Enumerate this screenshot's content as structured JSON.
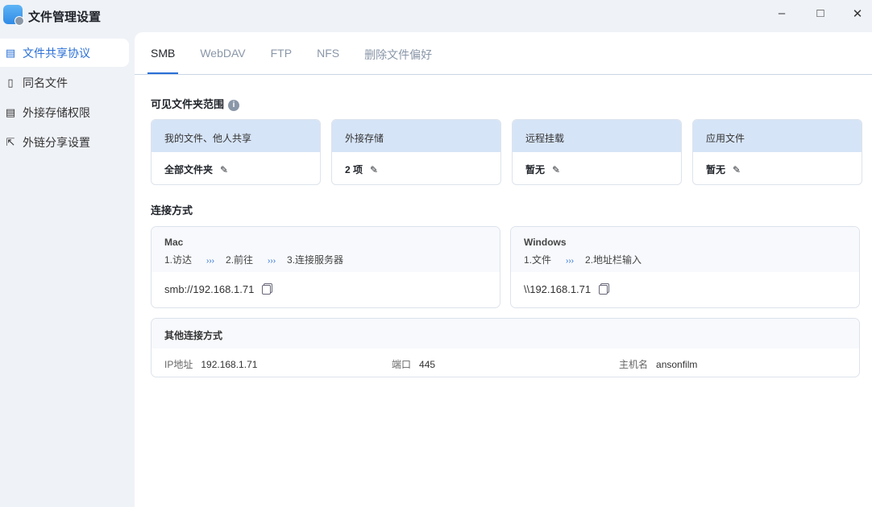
{
  "window": {
    "title": "文件管理设置"
  },
  "sidebar": {
    "items": [
      {
        "label": "文件共享协议"
      },
      {
        "label": "同名文件"
      },
      {
        "label": "外接存储权限"
      },
      {
        "label": "外链分享设置"
      }
    ]
  },
  "tabs": [
    "SMB",
    "WebDAV",
    "FTP",
    "NFS",
    "删除文件偏好"
  ],
  "visible_scope": {
    "title": "可见文件夹范围",
    "cards": [
      {
        "header": "我的文件、他人共享",
        "value": "全部文件夹"
      },
      {
        "header": "外接存储",
        "value": "2 项"
      },
      {
        "header": "远程挂载",
        "value": "暂无"
      },
      {
        "header": "应用文件",
        "value": "暂无"
      }
    ]
  },
  "connection": {
    "title": "连接方式",
    "mac": {
      "os": "Mac",
      "steps": [
        "1.访达",
        "2.前往",
        "3.连接服务器"
      ],
      "address": "smb://192.168.1.71"
    },
    "windows": {
      "os": "Windows",
      "steps": [
        "1.文件",
        "2.地址栏输入"
      ],
      "address": "\\\\192.168.1.71"
    },
    "other": {
      "title": "其他连接方式",
      "ip_label": "IP地址",
      "ip": "192.168.1.71",
      "port_label": "端口",
      "port": "445",
      "host_label": "主机名",
      "host": "ansonfilm"
    }
  },
  "accent": "#2a6fd6"
}
